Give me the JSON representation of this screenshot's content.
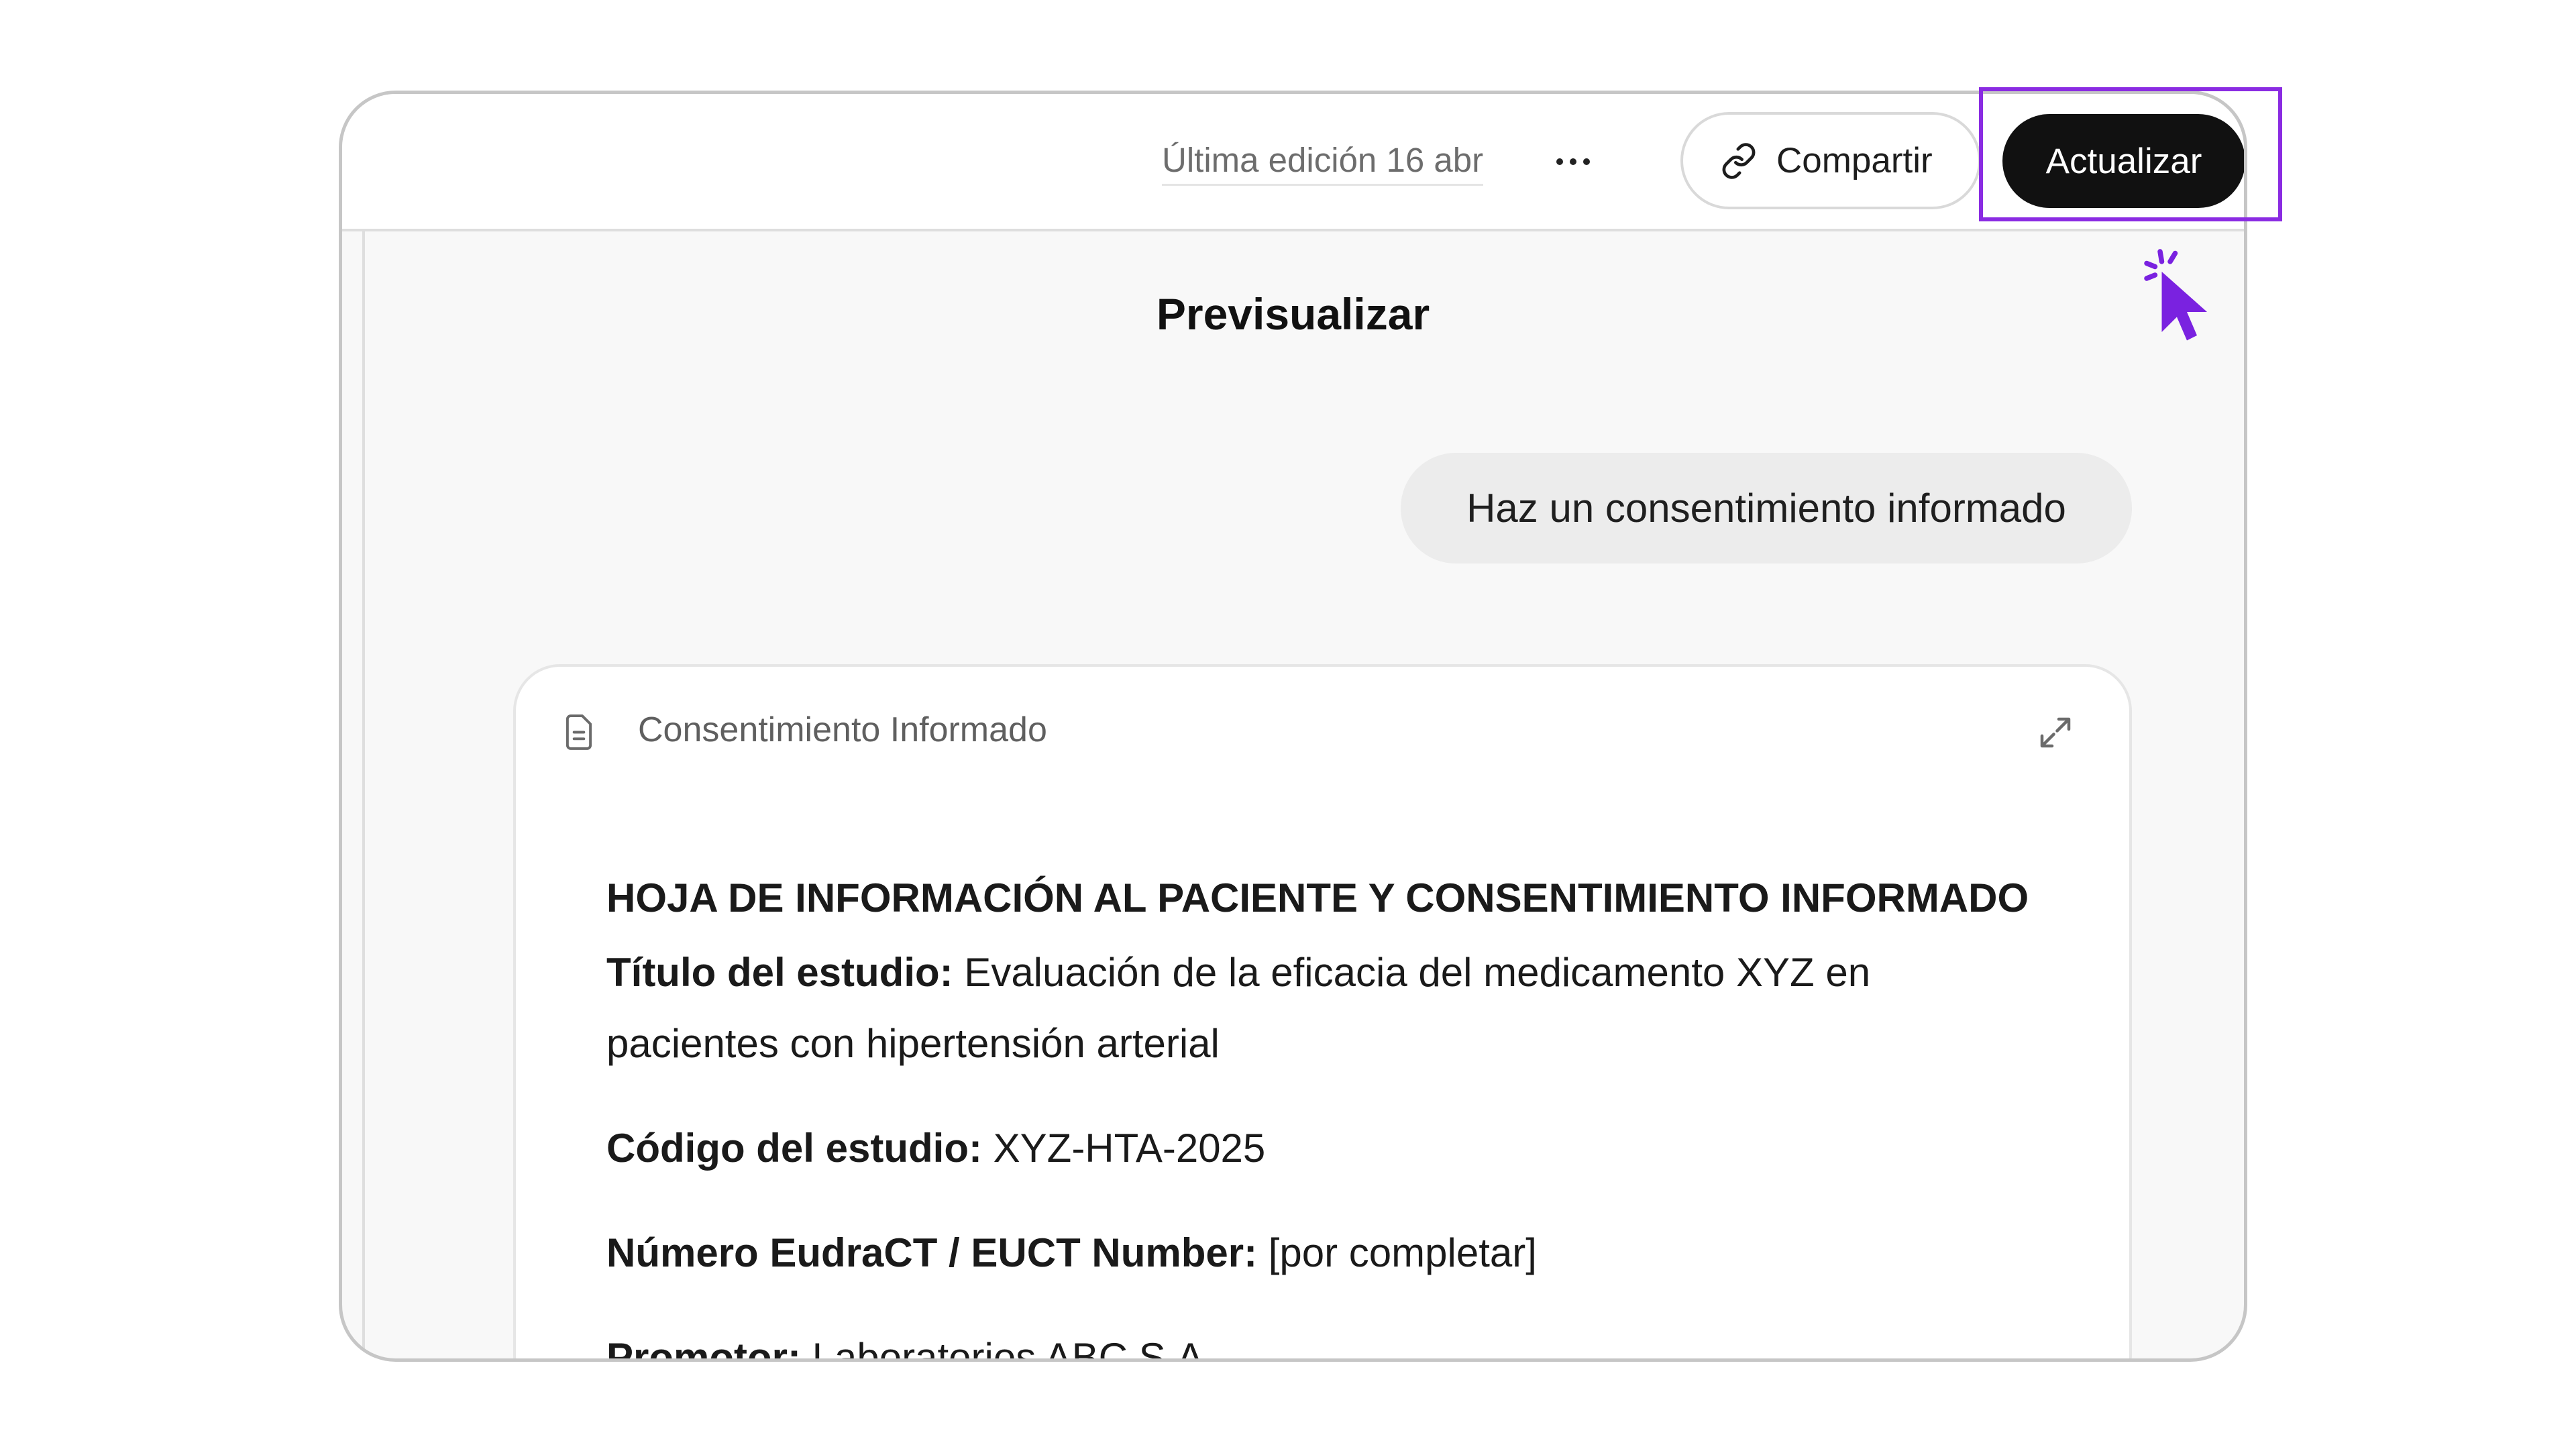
{
  "topbar": {
    "last_edit": "Última edición 16 abr",
    "more_icon": "more-horizontal-icon",
    "share_label": "Compartir",
    "share_icon": "link-icon",
    "update_label": "Actualizar"
  },
  "preview": {
    "title": "Previsualizar"
  },
  "chat": {
    "user_message": "Haz un consentimiento informado"
  },
  "document_card": {
    "icon": "document-icon",
    "title": "Consentimiento Informado",
    "expand_icon": "expand-icon",
    "heading": "HOJA DE INFORMACIÓN AL PACIENTE Y CONSENTIMIENTO INFORMADO",
    "fields": [
      {
        "label": "Título del estudio:",
        "value": "Evaluación de la eficacia del medicamento XYZ en pacientes con hipertensión arterial"
      },
      {
        "label": "Código del estudio:",
        "value": "XYZ-HTA-2025"
      },
      {
        "label": "Número EudraCT / EUCT Number:",
        "value": "[por completar]"
      },
      {
        "label": "Promotor:",
        "value": "Laboratorios ABC S.A."
      }
    ]
  },
  "annotation": {
    "highlight_color": "#8a2be2",
    "cursor_icon": "click-cursor-icon"
  }
}
